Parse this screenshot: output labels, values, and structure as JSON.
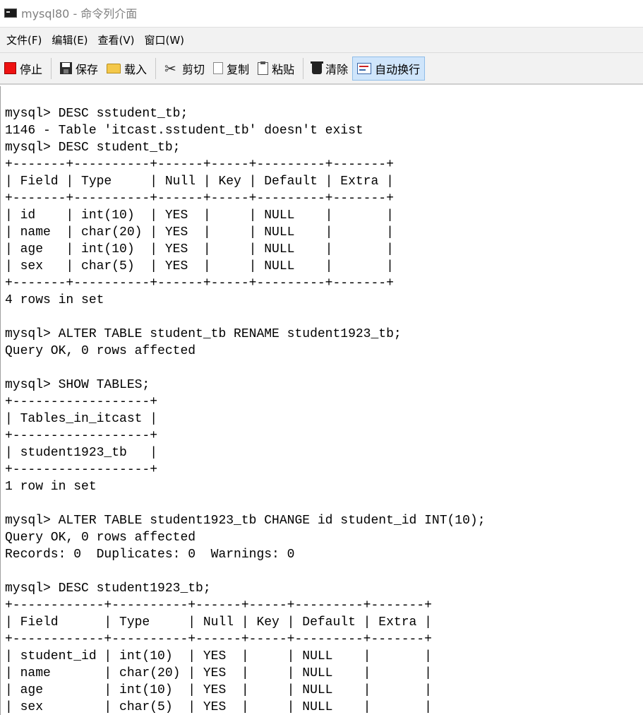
{
  "window": {
    "title": "mysql80 - 命令列介面"
  },
  "menu": [
    {
      "label": "文件(F)"
    },
    {
      "label": "编辑(E)"
    },
    {
      "label": "查看(V)"
    },
    {
      "label": "窗口(W)"
    }
  ],
  "toolbar": {
    "stop": "停止",
    "save": "保存",
    "load": "载入",
    "cut": "剪切",
    "copy": "复制",
    "paste": "粘贴",
    "clear": "清除",
    "wrap": "自动换行"
  },
  "icons": {
    "app": "console-icon",
    "stop": "stop-icon",
    "save": "save-icon",
    "load": "folder-icon",
    "cut": "scissors-icon",
    "copy": "copy-icon",
    "paste": "clipboard-icon",
    "clear": "trash-icon",
    "wrap": "word-wrap-icon"
  },
  "console_lines": [
    "mysql> DESC sstudent_tb;",
    "1146 - Table 'itcast.sstudent_tb' doesn't exist",
    "mysql> DESC student_tb;",
    "+-------+----------+------+-----+---------+-------+",
    "| Field | Type     | Null | Key | Default | Extra |",
    "+-------+----------+------+-----+---------+-------+",
    "| id    | int(10)  | YES  |     | NULL    |       |",
    "| name  | char(20) | YES  |     | NULL    |       |",
    "| age   | int(10)  | YES  |     | NULL    |       |",
    "| sex   | char(5)  | YES  |     | NULL    |       |",
    "+-------+----------+------+-----+---------+-------+",
    "4 rows in set",
    "",
    "mysql> ALTER TABLE student_tb RENAME student1923_tb;",
    "Query OK, 0 rows affected",
    "",
    "mysql> SHOW TABLES;",
    "+------------------+",
    "| Tables_in_itcast |",
    "+------------------+",
    "| student1923_tb   |",
    "+------------------+",
    "1 row in set",
    "",
    "mysql> ALTER TABLE student1923_tb CHANGE id student_id INT(10);",
    "Query OK, 0 rows affected",
    "Records: 0  Duplicates: 0  Warnings: 0",
    "",
    "mysql> DESC student1923_tb;",
    "+------------+----------+------+-----+---------+-------+",
    "| Field      | Type     | Null | Key | Default | Extra |",
    "+------------+----------+------+-----+---------+-------+",
    "| student_id | int(10)  | YES  |     | NULL    |       |",
    "| name       | char(20) | YES  |     | NULL    |       |",
    "| age        | int(10)  | YES  |     | NULL    |       |",
    "| sex        | char(5)  | YES  |     | NULL    |       |"
  ]
}
